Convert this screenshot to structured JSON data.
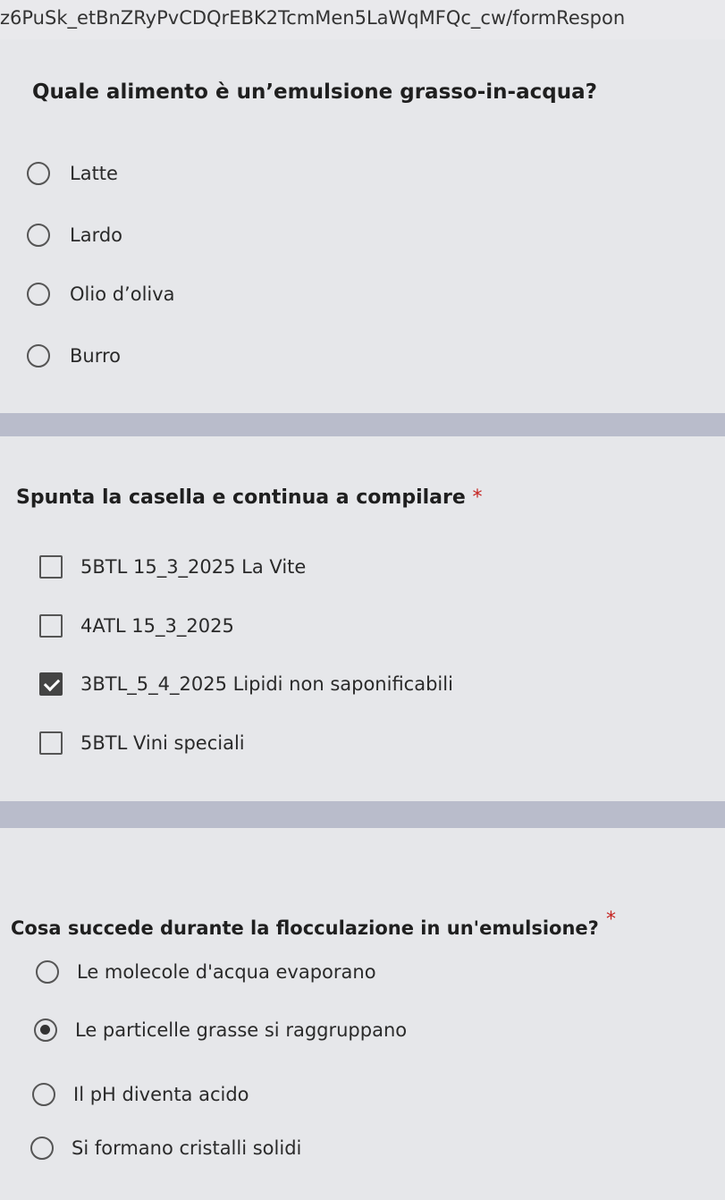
{
  "url_text": "z6PuSk_etBnZRyPvCDQrEBK2TcmMen5LaWqMFQc_cw/formRespon",
  "q1": {
    "title": "Quale alimento è un’emulsione grasso-in-acqua?",
    "options": [
      "Latte",
      "Lardo",
      "Olio d’oliva",
      "Burro"
    ]
  },
  "q2": {
    "title": "Spunta la casella e continua a compilare",
    "required_mark": "*",
    "options": [
      {
        "label": "5BTL 15_3_2025 La Vite",
        "checked": false
      },
      {
        "label": "4ATL 15_3_2025",
        "checked": false
      },
      {
        "label": "3BTL_5_4_2025 Lipidi non saponificabili",
        "checked": true
      },
      {
        "label": "5BTL Vini speciali",
        "checked": false
      }
    ]
  },
  "q3": {
    "title": "Cosa succede durante la flocculazione in un'emulsione?",
    "required_mark": "*",
    "options": [
      {
        "label": "Le molecole d'acqua evaporano",
        "selected": false
      },
      {
        "label": "Le particelle grasse si raggruppano",
        "selected": true
      },
      {
        "label": "Il pH diventa acido",
        "selected": false
      },
      {
        "label": "Si formano cristalli solidi",
        "selected": false
      }
    ]
  }
}
